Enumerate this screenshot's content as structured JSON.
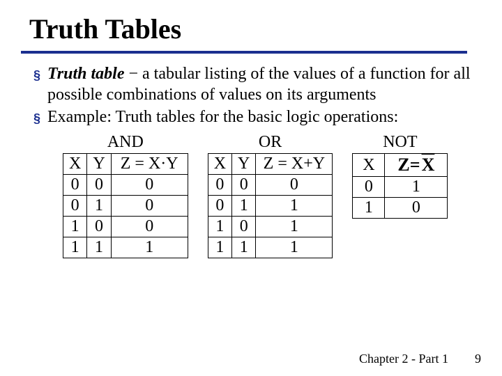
{
  "title": "Truth Tables",
  "bullets": {
    "b1_term": "Truth table",
    "b1_rest": " − a tabular listing of the values of a function for all possible combinations of values on its arguments",
    "b2": "Example: Truth tables for the basic logic operations:"
  },
  "and": {
    "title": "AND",
    "h": {
      "x": "X",
      "y": "Y",
      "z": "Z = X·Y"
    },
    "rows": [
      {
        "x": "0",
        "y": "0",
        "z": "0"
      },
      {
        "x": "0",
        "y": "1",
        "z": "0"
      },
      {
        "x": "1",
        "y": "0",
        "z": "0"
      },
      {
        "x": "1",
        "y": "1",
        "z": "1"
      }
    ]
  },
  "or": {
    "title": "OR",
    "h": {
      "x": "X",
      "y": "Y",
      "z": "Z = X+Y"
    },
    "rows": [
      {
        "x": "0",
        "y": "0",
        "z": "0"
      },
      {
        "x": "0",
        "y": "1",
        "z": "1"
      },
      {
        "x": "1",
        "y": "0",
        "z": "1"
      },
      {
        "x": "1",
        "y": "1",
        "z": "1"
      }
    ]
  },
  "not": {
    "title": "NOT",
    "h": {
      "x": "X",
      "zpre": "Z=",
      "zvar": "X"
    },
    "rows": [
      {
        "x": "0",
        "z": "1"
      },
      {
        "x": "1",
        "z": "0"
      }
    ]
  },
  "footer": {
    "chapter": "Chapter 2 - Part 1",
    "page": "9"
  },
  "chart_data": [
    {
      "type": "table",
      "title": "AND",
      "columns": [
        "X",
        "Y",
        "Z = X·Y"
      ],
      "rows": [
        [
          0,
          0,
          0
        ],
        [
          0,
          1,
          0
        ],
        [
          1,
          0,
          0
        ],
        [
          1,
          1,
          1
        ]
      ]
    },
    {
      "type": "table",
      "title": "OR",
      "columns": [
        "X",
        "Y",
        "Z = X+Y"
      ],
      "rows": [
        [
          0,
          0,
          0
        ],
        [
          0,
          1,
          1
        ],
        [
          1,
          0,
          1
        ],
        [
          1,
          1,
          1
        ]
      ]
    },
    {
      "type": "table",
      "title": "NOT",
      "columns": [
        "X",
        "Z = NOT X"
      ],
      "rows": [
        [
          0,
          1
        ],
        [
          1,
          0
        ]
      ]
    }
  ]
}
